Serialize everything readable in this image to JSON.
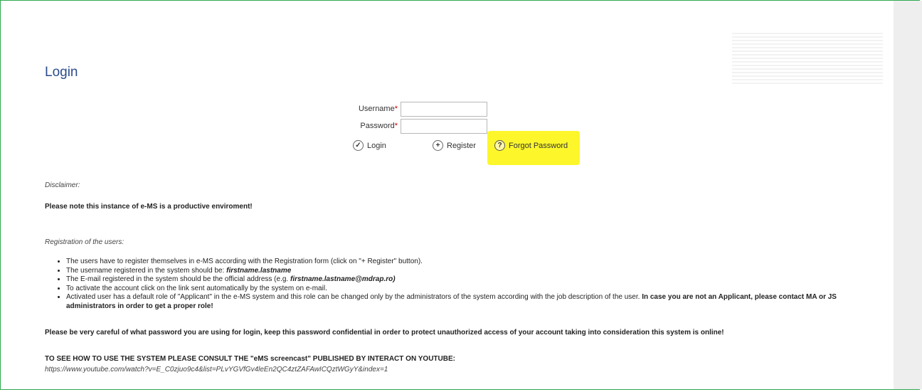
{
  "page": {
    "title": "Login"
  },
  "form": {
    "username_label": "Username",
    "password_label": "Password",
    "required_mark": "*",
    "username_value": "",
    "password_value": "",
    "login_label": "Login",
    "register_label": "Register",
    "forgot_label": "Forgot Password"
  },
  "icons": {
    "login": "check-icon",
    "register": "plus-icon",
    "forgot": "question-icon"
  },
  "colors": {
    "title": "#2b4c8c",
    "highlight": "#fcf62b",
    "frame_border": "#2ea84f"
  },
  "disclaimer": {
    "heading": "Disclaimer:",
    "notice": "Please note this instance of e-MS is a productive enviroment!"
  },
  "registration": {
    "heading": "Registration of the users:",
    "items": [
      {
        "text": "The users have to register themselves in e-MS according with the Registration form (click on \"+ Register\" button)."
      },
      {
        "pre": "The username registered in the system should be: ",
        "em": "firstname.lastname"
      },
      {
        "pre": "The E-mail registered in the system should be the official address (e.g. ",
        "em": "firstname.lastname@mdrap.ro)"
      },
      {
        "text": "To activate the account click on the link sent automatically by the system on e-mail."
      },
      {
        "pre": "Activated user has a default role of \"Applicant\" in the e-MS system and this role can be changed only by the administrators of the system according with the job description of the user. ",
        "bold": "In case you are not an Applicant, please contact MA or JS administrators in order to get a proper role!"
      }
    ]
  },
  "warning": "Please be very careful of what password you are using for login, keep this password confidential in order to protect unauthorized access of your account taking into consideration this system is online!",
  "screencast": {
    "heading": "TO SEE HOW TO USE THE SYSTEM PLEASE CONSULT THE \"eMS screencast\" PUBLISHED BY INTERACT ON YOUTUBE:",
    "url": "https://www.youtube.com/watch?v=E_C0zjuo9c4&list=PLvYGVfGv4leEn2QC4ztZAFAwICQztWGyY&index=1"
  }
}
